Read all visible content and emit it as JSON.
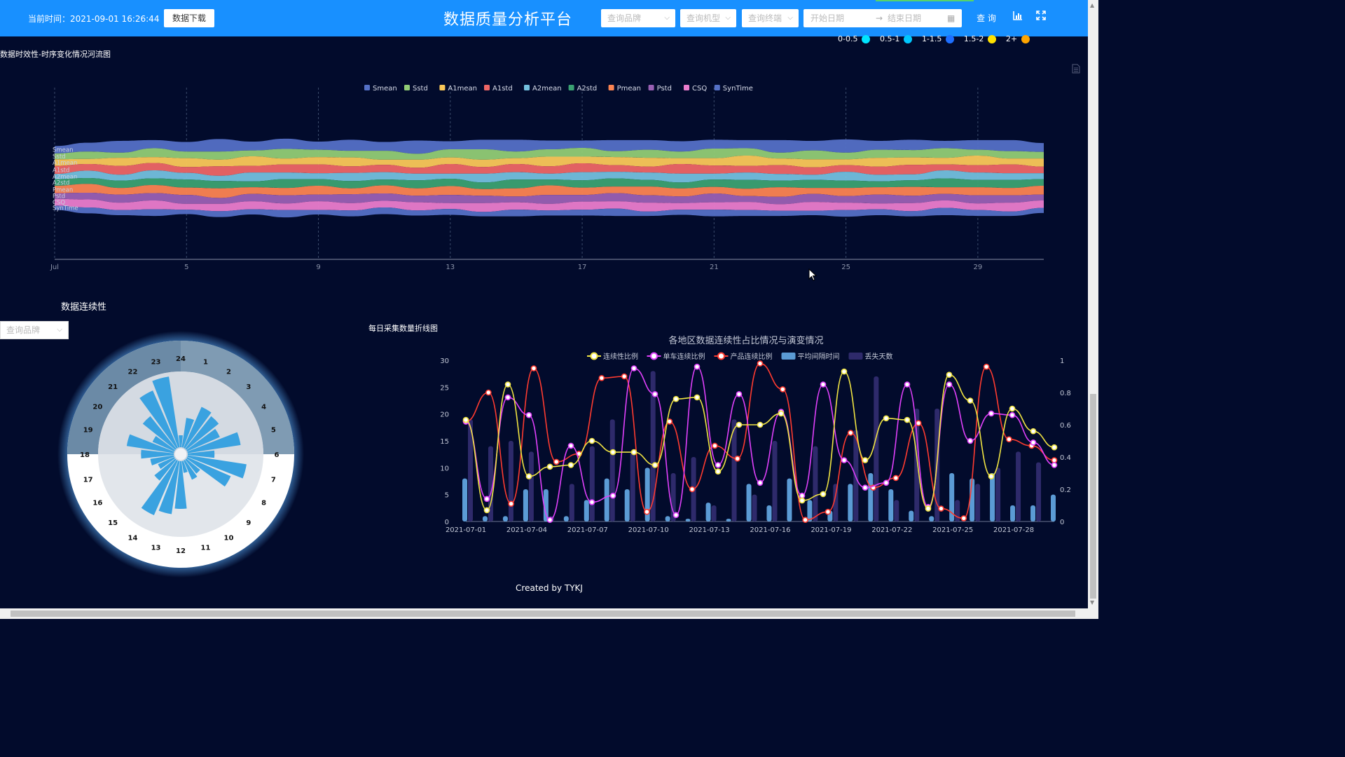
{
  "header": {
    "time_label": "当前时间：2021-09-01 16:26:44",
    "download_label": "数据下载",
    "title": "数据质量分析平台",
    "brand_placeholder": "查询品牌",
    "model_placeholder": "查询机型",
    "terminal_placeholder": "查询终端",
    "start_date_placeholder": "开始日期",
    "end_date_placeholder": "结束日期",
    "range_arrow": "→",
    "query_label": "查 询"
  },
  "top_legend": [
    {
      "label": "0-0.5",
      "color": "#00e5ff"
    },
    {
      "label": "0.5-1",
      "color": "#00c8ff"
    },
    {
      "label": "1-1.5",
      "color": "#1e6fff"
    },
    {
      "label": "1.5-2",
      "color": "#ffe100"
    },
    {
      "label": "2+",
      "color": "#ffa500"
    }
  ],
  "sections": {
    "river_title": "数据时效性-时序变化情况河流图",
    "continuity_title": "数据连续性",
    "line_title": "每日采集数量折线图",
    "combo_title": "各地区数据连续性占比情况与演变情况",
    "picker_placeholder": "查询品牌",
    "credit": "Created by TYKJ"
  },
  "chart_data": [
    {
      "type": "area",
      "subtype": "themeRiver",
      "legend": [
        "Smean",
        "Sstd",
        "A1mean",
        "A1std",
        "A2mean",
        "A2std",
        "Pmean",
        "Pstd",
        "CSQ",
        "SynTime"
      ],
      "colors": [
        "#5470c6",
        "#91cc75",
        "#fac858",
        "#ee6666",
        "#73c0de",
        "#3ba272",
        "#fc8452",
        "#9a60b4",
        "#ea7ccc",
        "#5470c6"
      ],
      "x_ticks": [
        "Jul",
        "5",
        "9",
        "13",
        "17",
        "21",
        "25",
        "29"
      ],
      "x_days": [
        1,
        5,
        9,
        13,
        17,
        21,
        25,
        29
      ],
      "series": [
        {
          "name": "Smean",
          "values": [
            10,
            12,
            16,
            11,
            13,
            17,
            12,
            14,
            11,
            15,
            12,
            18,
            11,
            13,
            16,
            12,
            10,
            15,
            13,
            14,
            12,
            11,
            17,
            13,
            18,
            12,
            14,
            10,
            13,
            15,
            12
          ]
        },
        {
          "name": "Sstd",
          "values": [
            8,
            10,
            7,
            12,
            9,
            11,
            8,
            13,
            10,
            9,
            12,
            8,
            11,
            14,
            9,
            10,
            12,
            8,
            11,
            9,
            13,
            10,
            8,
            12,
            9,
            11,
            10,
            13,
            8,
            10,
            9
          ]
        },
        {
          "name": "A1mean",
          "values": [
            9,
            7,
            11,
            8,
            12,
            9,
            13,
            8,
            10,
            12,
            7,
            11,
            9,
            10,
            8,
            13,
            9,
            11,
            12,
            8,
            10,
            14,
            9,
            11,
            8,
            12,
            10,
            9,
            13,
            8,
            11
          ]
        },
        {
          "name": "A1std",
          "values": [
            11,
            9,
            12,
            10,
            8,
            13,
            9,
            11,
            12,
            9,
            10,
            8,
            13,
            9,
            11,
            10,
            12,
            9,
            8,
            13,
            11,
            9,
            12,
            10,
            9,
            11,
            13,
            8,
            10,
            12,
            9
          ]
        },
        {
          "name": "A2mean",
          "values": [
            7,
            10,
            8,
            11,
            9,
            7,
            12,
            9,
            8,
            11,
            10,
            9,
            7,
            12,
            10,
            8,
            11,
            9,
            10,
            12,
            8,
            10,
            9,
            7,
            12,
            9,
            8,
            11,
            10,
            9,
            8
          ]
        },
        {
          "name": "A2std",
          "values": [
            9,
            8,
            10,
            9,
            11,
            10,
            8,
            12,
            9,
            10,
            8,
            11,
            10,
            9,
            12,
            8,
            10,
            11,
            9,
            8,
            10,
            12,
            9,
            11,
            10,
            8,
            9,
            12,
            10,
            11,
            9
          ]
        },
        {
          "name": "Pmean",
          "values": [
            10,
            12,
            9,
            11,
            10,
            13,
            9,
            10,
            12,
            8,
            11,
            10,
            12,
            9,
            11,
            13,
            10,
            9,
            12,
            11,
            9,
            10,
            13,
            8,
            11,
            10,
            12,
            9,
            11,
            10,
            12
          ]
        },
        {
          "name": "Pstd",
          "values": [
            8,
            9,
            11,
            10,
            12,
            8,
            10,
            11,
            9,
            12,
            10,
            9,
            11,
            10,
            8,
            12,
            9,
            11,
            10,
            9,
            12,
            8,
            10,
            11,
            9,
            12,
            10,
            9,
            11,
            10,
            8
          ]
        },
        {
          "name": "CSQ",
          "values": [
            9,
            11,
            10,
            12,
            8,
            10,
            11,
            9,
            12,
            10,
            9,
            11,
            8,
            12,
            10,
            9,
            11,
            10,
            12,
            9,
            10,
            11,
            9,
            12,
            10,
            8,
            11,
            10,
            9,
            12,
            10
          ]
        },
        {
          "name": "SynTime",
          "values": [
            6,
            8,
            7,
            9,
            6,
            8,
            7,
            10,
            6,
            8,
            9,
            7,
            8,
            6,
            9,
            7,
            8,
            10,
            6,
            7,
            9,
            8,
            7,
            6,
            9,
            8,
            7,
            10,
            8,
            6,
            7
          ]
        }
      ]
    },
    {
      "type": "bar",
      "subtype": "polar-radial",
      "angle_labels": [
        "1",
        "2",
        "3",
        "4",
        "5",
        "6",
        "7",
        "8",
        "9",
        "10",
        "11",
        "12",
        "13",
        "14",
        "15",
        "16",
        "17",
        "18",
        "19",
        "20",
        "21",
        "22",
        "23",
        "24"
      ],
      "values": [
        10,
        15,
        14,
        12,
        18,
        9,
        20,
        16,
        6,
        7,
        4,
        16,
        18,
        20,
        9,
        6,
        8,
        11,
        16,
        8,
        14,
        21,
        24,
        4
      ]
    },
    {
      "type": "line",
      "subtype": "combo-line-bar",
      "legend": [
        "连续性比例",
        "单车连续比例",
        "产品连续比例",
        "平均间隔时间",
        "丢失天数"
      ],
      "legend_colors": [
        "#f0e442",
        "#e040fb",
        "#ff3b30",
        "#5b9bd5",
        "#2e2a6b"
      ],
      "x_labels": [
        "2021-07-01",
        "2021-07-04",
        "2021-07-07",
        "2021-07-10",
        "2021-07-13",
        "2021-07-16",
        "2021-07-19",
        "2021-07-22",
        "2021-07-25",
        "2021-07-28"
      ],
      "y_left": [
        0,
        5,
        10,
        15,
        20,
        25,
        30
      ],
      "y_right": [
        0,
        0.2,
        0.4,
        0.6,
        0.8,
        1
      ],
      "series": [
        {
          "name": "连续性比例",
          "axis": "right",
          "values": [
            0.63,
            0.07,
            0.85,
            0.28,
            0.34,
            0.35,
            0.5,
            0.43,
            0.43,
            0.35,
            0.76,
            0.77,
            0.31,
            0.6,
            0.6,
            0.67,
            0.13,
            0.17,
            0.93,
            0.38,
            0.64,
            0.63,
            0.08,
            0.91,
            0.75,
            0.28,
            0.7,
            0.56,
            0.46
          ]
        },
        {
          "name": "单车连续比例",
          "axis": "right",
          "values": [
            0.62,
            0.14,
            0.77,
            0.66,
            0.01,
            0.47,
            0.12,
            0.16,
            0.95,
            0.79,
            0.04,
            0.96,
            0.35,
            0.79,
            0.24,
            0.68,
            0.16,
            0.85,
            0.38,
            0.21,
            0.24,
            0.85,
            0.09,
            0.85,
            0.5,
            0.67,
            0.66,
            0.49,
            0.35
          ]
        },
        {
          "name": "产品连续比例",
          "axis": "right",
          "values": [
            0.62,
            0.8,
            0.11,
            0.95,
            0.37,
            0.42,
            0.89,
            0.9,
            0.06,
            0.62,
            0.2,
            0.47,
            0.39,
            0.98,
            0.82,
            0.01,
            0.06,
            0.55,
            0.21,
            0.27,
            0.61,
            0.08,
            0.02,
            0.96,
            0.51,
            0.47,
            0.38
          ]
        },
        {
          "name": "平均间隔时间",
          "axis": "left",
          "type": "bar",
          "values": [
            8,
            1,
            1,
            6,
            6,
            1,
            4,
            8,
            6,
            10,
            1,
            0.5,
            3.5,
            0.5,
            7,
            3,
            8,
            4,
            2,
            7,
            9,
            6,
            2,
            1,
            9,
            8,
            9,
            3,
            3,
            5
          ]
        },
        {
          "name": "丢失天数",
          "axis": "left",
          "type": "bar",
          "values": [
            19,
            14,
            15,
            13,
            1,
            7,
            14,
            19,
            13,
            28,
            9,
            12,
            3,
            19,
            5,
            15,
            0,
            14,
            7,
            17,
            27,
            4,
            21,
            21,
            4,
            7,
            10,
            13,
            11
          ]
        }
      ]
    }
  ]
}
